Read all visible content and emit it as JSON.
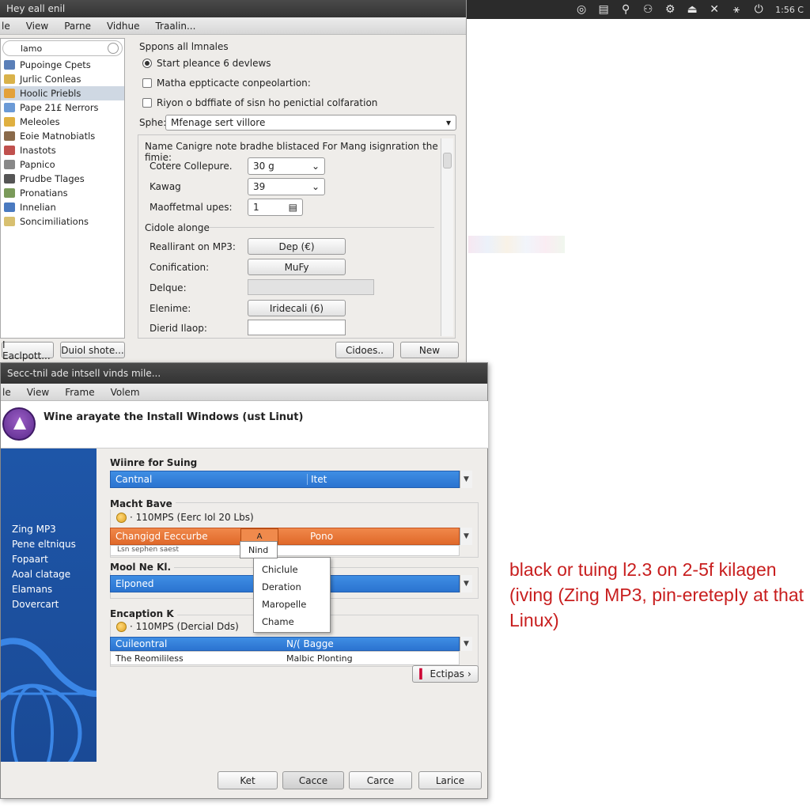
{
  "topbar": {
    "icons": [
      "chrome-icon",
      "document-icon",
      "pin-icon",
      "user-icon",
      "settings-icon",
      "drive-icon",
      "close-x-icon",
      "network-icon",
      "power-icon"
    ],
    "clock": "1:56 C"
  },
  "win1": {
    "title": "Hey eall enil",
    "menu": [
      "le",
      "View",
      "Parne",
      "Vidhue",
      "Traalin..."
    ],
    "search": "lamo",
    "sidebar": [
      {
        "label": "Pupoinge Cpets",
        "color": "#5a7fb8"
      },
      {
        "label": "Jurlic Conleas",
        "color": "#d9b24a"
      },
      {
        "label": "Hoolic Priebls",
        "color": "#e3a13a"
      },
      {
        "label": "Pape 21£ Nerrors",
        "color": "#6b9ad6"
      },
      {
        "label": "Meleoles",
        "color": "#e0b040"
      },
      {
        "label": "Eoie Matnobiatls",
        "color": "#8a6a4a"
      },
      {
        "label": "Inastots",
        "color": "#c0504d"
      },
      {
        "label": "Papnico",
        "color": "#888888"
      },
      {
        "label": "Prudbe Tlages",
        "color": "#555555"
      },
      {
        "label": "Pronatians",
        "color": "#7a9a5a"
      },
      {
        "label": "Innelian",
        "color": "#4a7ac0"
      },
      {
        "label": "Soncimiliations",
        "color": "#d8c070"
      }
    ],
    "footer_buttons": [
      "I Eaclpott...",
      "Duiol shote..."
    ],
    "section_title": "Sppons all lmnales",
    "options": [
      {
        "label": "Start pleance 6 devlews",
        "type": "radio"
      },
      {
        "label": "Matha eppticacte conpeolartion:",
        "type": "check"
      },
      {
        "label": "Riyon o bdffiate of sisn ho penictial colfaration",
        "type": "check"
      }
    ],
    "sphe_label": "Sphe:",
    "sphe_value": "Mfenage sert villore",
    "panel_title": "Name Canigre note bradhe blistaced For Mang isignration the fimie:",
    "combos": [
      {
        "label": "Cotere Collepure.",
        "value": "30 g"
      },
      {
        "label": "Kawag",
        "value": "39"
      }
    ],
    "spin": {
      "label": "Maoffetmal upes:",
      "value": "1"
    },
    "cidole": "Cidole alonge",
    "rows": [
      {
        "label": "Reallirant on MP3:",
        "button": "Dep (€)"
      },
      {
        "label": "Conification:",
        "button": "MuFy"
      },
      {
        "label": "Delque:",
        "button": ""
      },
      {
        "label": "Elenime:",
        "button": "Iridecali (6)"
      },
      {
        "label": "Dierid Ilaop:",
        "button": ""
      }
    ],
    "bottom_buttons": [
      "Cidoes..",
      "New"
    ]
  },
  "win2": {
    "title": "Secc-tnil ade intsell vinds mile...",
    "menu": [
      "le",
      "View",
      "Frame",
      "Volem"
    ],
    "header": "Wine arayate the Install Windows (ust Linut)",
    "bluepanel": [
      "Zing MP3",
      "Pene eltniqus",
      "Fopaart",
      "Aoal clatage",
      "Elamans",
      "Dovercart"
    ],
    "group1_title": "Wiinre for Suing",
    "group1_bar": [
      "Cantnal",
      "Itet"
    ],
    "group2_title": "Macht Bave",
    "group2_info": "· 110MPS (Eerc Iol 20 Lbs)",
    "group2_orange": [
      "Changigd Eeccurbe",
      "Pono"
    ],
    "group2_sub": "Lsn sephen saest",
    "group2_dropbtn": "A",
    "group3_title": "Mool Ne Kl.",
    "group3_bar": "Elponed",
    "group4_title": "Encaption K",
    "group4_info": "· 110MPS (Dercial Dds)",
    "group4_rows": [
      [
        "Cuileontral",
        "N/( Bagge"
      ],
      [
        "The Reomililess",
        "Malbic Plonting"
      ]
    ],
    "eclipse_btn": "Ectipas",
    "popup": [
      "Nind",
      "Chiclule",
      "Deration",
      "Maropelle",
      "Chame"
    ],
    "bottom_buttons": [
      "Ket",
      "Cacce",
      "Carce",
      "Larice"
    ]
  },
  "caption": "black or tuing l2.3 on 2-5f kilagen (iving (Zing MP3, pin-eretepIy at that Linux)"
}
